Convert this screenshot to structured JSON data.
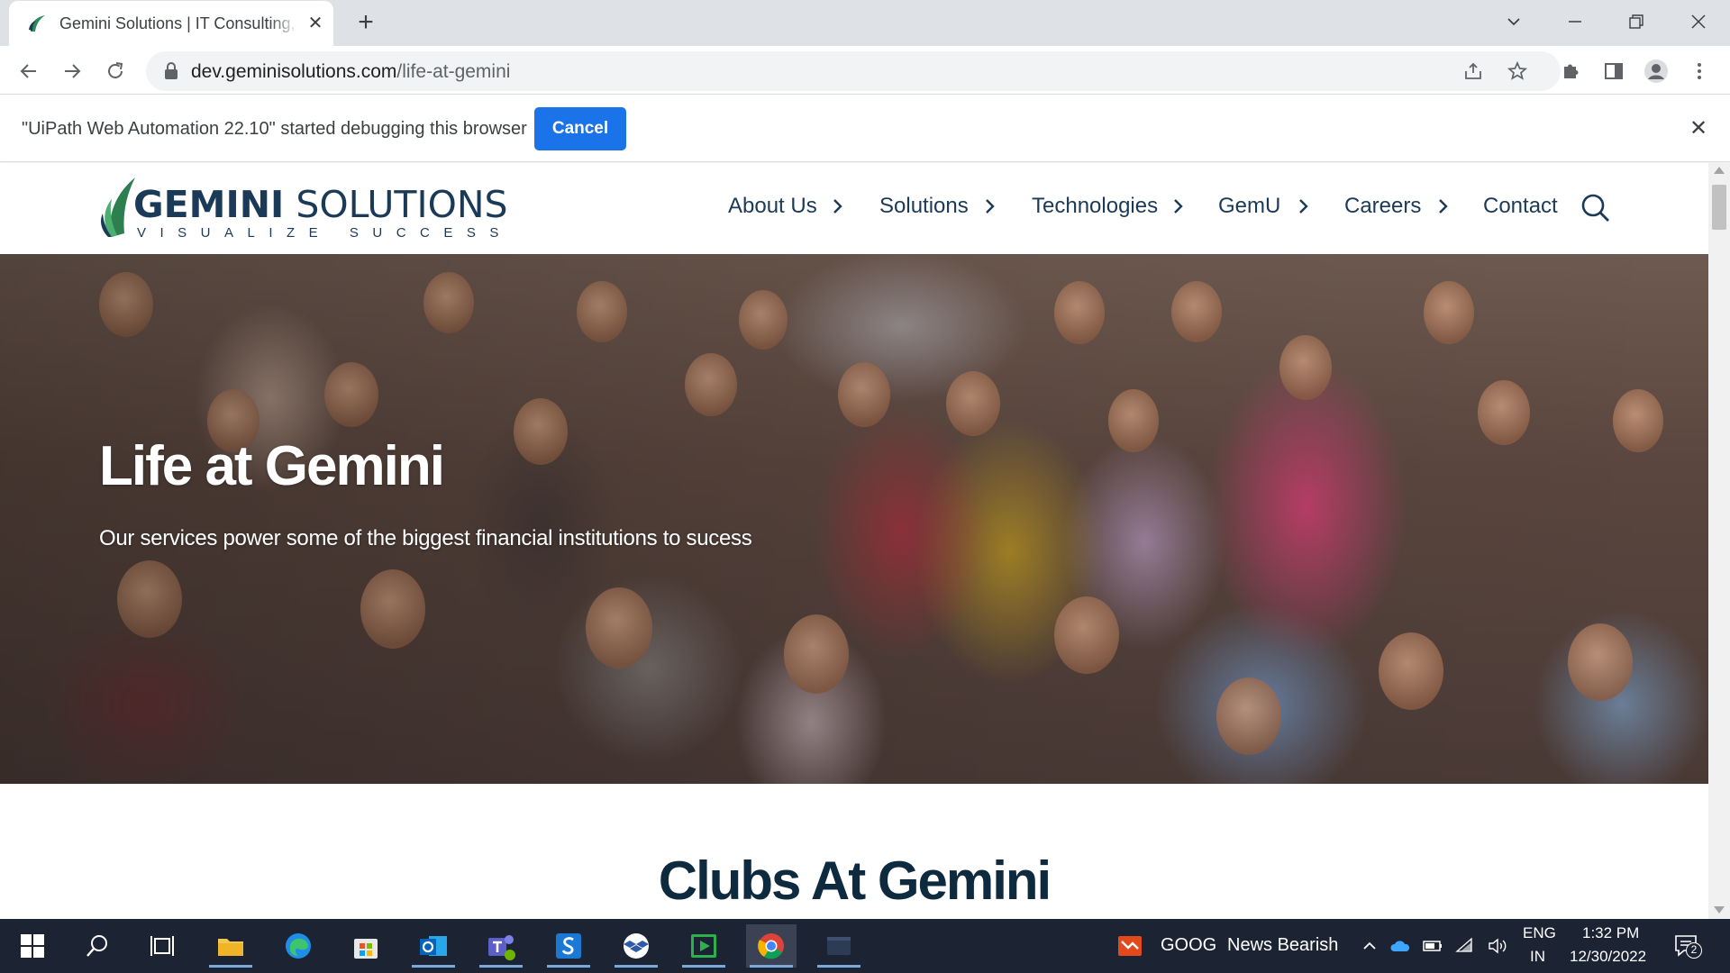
{
  "browser": {
    "tab_title": "Gemini Solutions | IT Consulting, Software Development",
    "tab_close": "✕",
    "new_tab": "+",
    "url_host": "dev.geminisolutions.com",
    "url_path": "/life-at-gemini",
    "debug_message": "\"UiPath Web Automation 22.10\" started debugging this browser",
    "debug_cancel": "Cancel",
    "debug_close": "✕"
  },
  "site": {
    "logo_name_bold": "GEMINI",
    "logo_name_light": " SOLUTIONS",
    "logo_tagline": "VISUALIZE SUCCESS",
    "nav": [
      "About Us",
      "Solutions",
      "Technologies",
      "GemU",
      "Careers",
      "Contact"
    ],
    "chevron": "›"
  },
  "hero": {
    "title": "Life at Gemini",
    "subtitle": "Our services power some of the biggest financial institutions to sucess"
  },
  "section": {
    "clubs_heading": "Clubs At Gemini"
  },
  "taskbar": {
    "news_ticker": "GOOG",
    "news_text": "News Bearish",
    "lang_top": "ENG",
    "lang_bottom": "IN",
    "time": "1:32 PM",
    "date": "12/30/2022",
    "notification_count": "2",
    "apps": [
      "start-icon",
      "search-icon",
      "task-view-icon",
      "file-explorer-icon",
      "edge-icon",
      "store-icon",
      "outlook-icon",
      "teams-icon",
      "skype-s-icon",
      "dropbox-icon",
      "media-player-icon",
      "chrome-icon",
      "terminal-icon"
    ]
  },
  "colors": {
    "brand_navy": "#1b3a57",
    "chrome_blue": "#1a73e8",
    "taskbar": "#1c2433"
  }
}
